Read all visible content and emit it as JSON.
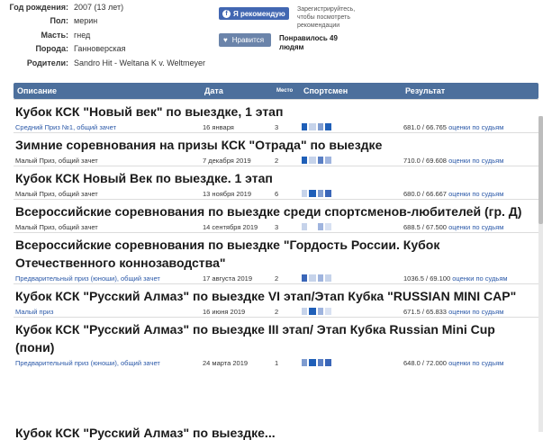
{
  "horse_info": [
    {
      "label": "Год рождения:",
      "value": "2007 (13 лет)"
    },
    {
      "label": "Пол:",
      "value": "мерин"
    },
    {
      "label": "Масть:",
      "value": "гнед"
    },
    {
      "label": "Порода:",
      "value": "Ганноверская"
    },
    {
      "label": "Родители:",
      "value": "Sandro Hit - Weltana K v. Weltmeyer"
    }
  ],
  "social": {
    "fb_label": "Я рекомендую",
    "fb_note": "Зарегистрируйтесь, чтобы посмотреть рекомендации",
    "like_label": "Нравится",
    "like_count_text": "Понравилось 49 людям"
  },
  "table": {
    "headers": {
      "description": "Описание",
      "date": "Дата",
      "place": "Место",
      "rider": "Спортсмен",
      "result": "Результат"
    },
    "entries": [
      {
        "title": "Кубок КСК \"Новый век\" по выездке, 1 этап",
        "category": "Средний Приз №1, общий зачет",
        "category_link": true,
        "date": "16 января",
        "place": "3",
        "result": "681.0 / 66.765",
        "ratings": "оценки по судьям",
        "rider_colors": [
          "#1f5fb8",
          "#c6d3ea",
          "#7f9cd0",
          "#1f5fb8"
        ]
      },
      {
        "title": "Зимние соревнования на призы КСК \"Отрада\" по выездке",
        "category": "Малый Приз, общий зачет",
        "category_link": false,
        "date": "7 декабря 2019",
        "place": "2",
        "result": "710.0 / 69.608",
        "ratings": "оценки по судьям",
        "rider_colors": [
          "#1f5fb8",
          "#c6d3ea",
          "#5a7fc4",
          "#9fb4de"
        ]
      },
      {
        "title": "Кубок КСК Новый Век по выездке. 1 этап",
        "category": "Малый Приз, общий зачет",
        "category_link": false,
        "date": "13 ноября 2019",
        "place": "6",
        "result": "680.0 / 66.667",
        "ratings": "оценки по судьям",
        "rider_colors": [
          "#c6d3ea",
          "#1f5fb8",
          "#7f9cd0",
          "#3a66b8"
        ]
      },
      {
        "title": "Всероссийские соревнования по выездке среди спортсменов-любителей (гр. Д)",
        "category": "Малый Приз, общий зачет",
        "category_link": false,
        "date": "14 сентября 2019",
        "place": "3",
        "result": "688.5 / 67.500",
        "ratings": "оценки по судьям",
        "rider_colors": [
          "#c6d3ea",
          "#ffffff",
          "#9fb4de",
          "#d8e1f2"
        ]
      },
      {
        "title": "Всероссийские соревнования по выездке \"Гордость России. Кубок Отечественного коннозаводства\"",
        "category": "Предварительный приз (юноши), общий зачет",
        "category_link": true,
        "date": "17 августа 2019",
        "place": "2",
        "result": "1036.5 / 69.100",
        "ratings": "оценки по судьям",
        "rider_colors": [
          "#3a66b8",
          "#c6d3ea",
          "#9fb4de",
          "#c6d3ea"
        ]
      },
      {
        "title": "Кубок КСК \"Русский Алмаз\" по выездке VI этап/Этап Кубка \"RUSSIAN MINI CAP\"",
        "category": "Малый приз",
        "category_link": true,
        "date": "16 июня 2019",
        "place": "2",
        "result": "671.5 / 65.833",
        "ratings": "оценки по судьям",
        "rider_colors": [
          "#c6d3ea",
          "#1f5fb8",
          "#9fb4de",
          "#d8e1f2"
        ]
      },
      {
        "title": "Кубок КСК \"Русский Алмаз\" по выездке III этап/ Этап Кубка Russian Mini Cup (пони)",
        "category": "Предварительный приз (юноши), общий зачет",
        "category_link": true,
        "date": "24 марта 2019",
        "place": "1",
        "result": "648.0 / 72.000",
        "ratings": "оценки по судьям",
        "rider_colors": [
          "#7f9cd0",
          "#1f5fb8",
          "#5a7fc4",
          "#3a66b8"
        ]
      }
    ],
    "partial_title": "Кубок КСК \"Русский Алмаз\" по выездке..."
  }
}
